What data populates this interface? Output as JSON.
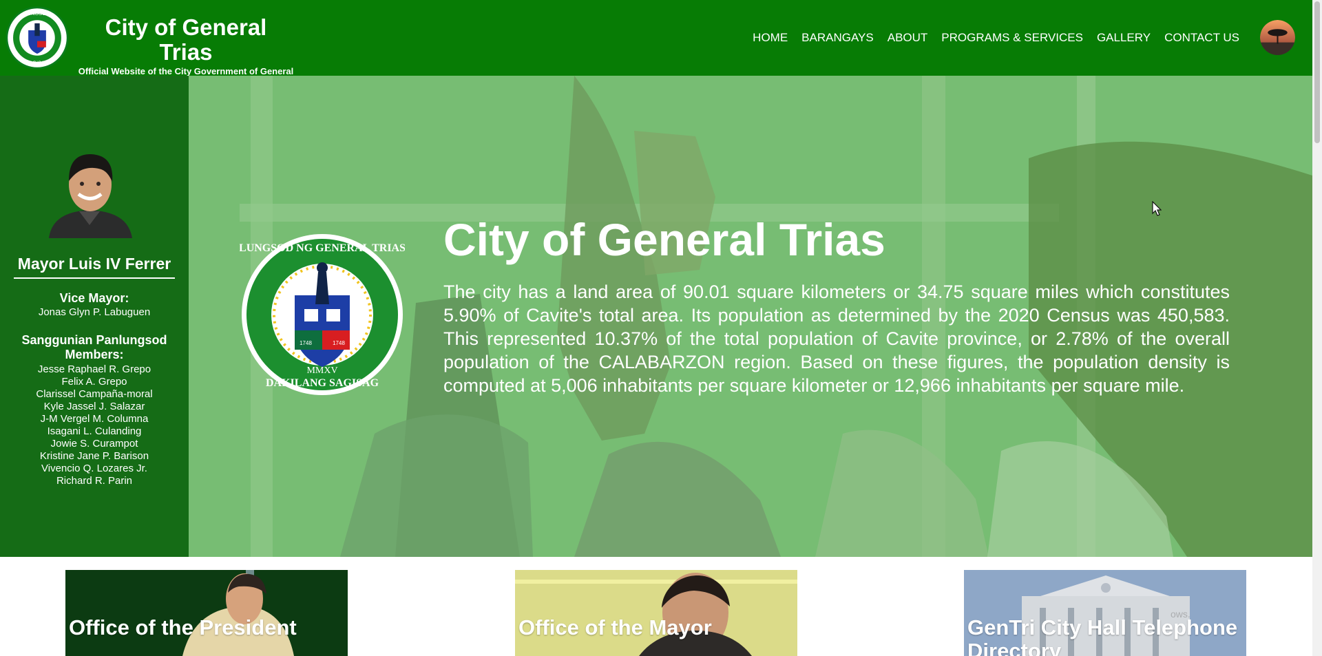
{
  "header": {
    "title": "City of General Trias",
    "subtitle": "Official Website of the City Government of General Trias Province of Cavite",
    "logo_icon": "city-seal-icon",
    "avatar_icon": "sunset-tree-avatar"
  },
  "nav": {
    "items": [
      "HOME",
      "BARANGAYS",
      "ABOUT",
      "PROGRAMS & SERVICES",
      "GALLERY",
      "CONTACT US"
    ]
  },
  "sidebar": {
    "mayor": "Mayor Luis IV Ferrer",
    "vice_mayor_label": "Vice Mayor:",
    "vice_mayor": "Jonas Glyn P. Labuguen",
    "council_label": "Sanggunian Panlungsod Members:",
    "members": [
      "Jesse Raphael R. Grepo",
      "Felix A. Grepo",
      "Clarissel Campaña-moral",
      "Kyle Jassel J. Salazar",
      "J-M Vergel M. Columna",
      "Isagani L. Culanding",
      "Jowie S. Curampot",
      "Kristine Jane P. Barison",
      "Vivencio Q. Lozares Jr.",
      "Richard R. Parin"
    ]
  },
  "hero": {
    "title": "City of General Trias",
    "description": "The city has a land area of 90.01 square kilometers or 34.75 square miles which constitutes 5.90% of Cavite's total area. Its population as determined by the 2020 Census was 450,583. This represented 10.37% of the total population of Cavite province, or 2.78% of the overall population of the CALABARZON region. Based on these figures, the population density is computed at 5,006 inhabitants per square kilometer or 12,966 inhabitants per square mile.",
    "seal": {
      "top_text": "LUNGSOD NG GENERAL TRIAS",
      "bottom_text": "DAKILANG SAGISAG",
      "year": "MMXV",
      "left_year": "1748",
      "right_year": "1748"
    }
  },
  "cards": [
    {
      "title": "Office of the President"
    },
    {
      "title": "Office of the Mayor"
    },
    {
      "title": "GenTri City Hall Telephone Directory"
    }
  ],
  "overlay": {
    "watermark": "ows."
  },
  "colors": {
    "header_green": "#077c05",
    "sidebar_green": "#156c16",
    "hero_overlay": "#74bc70",
    "text": "#ffffff"
  }
}
